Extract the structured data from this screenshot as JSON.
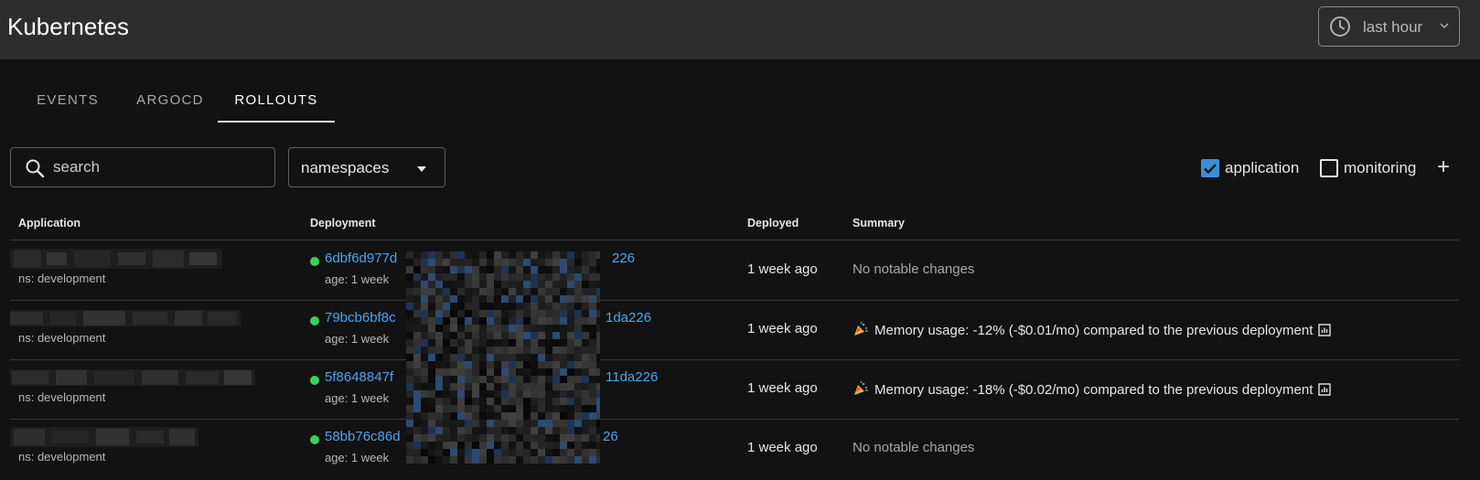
{
  "header": {
    "title": "Kubernetes",
    "time_range": "last hour"
  },
  "tabs": [
    {
      "label": "EVENTS",
      "active": false
    },
    {
      "label": "ARGOCD",
      "active": false
    },
    {
      "label": "ROLLOUTS",
      "active": true
    }
  ],
  "filters": {
    "search_placeholder": "search",
    "namespaces_label": "namespaces",
    "toggles": [
      {
        "label": "application",
        "checked": true
      },
      {
        "label": "monitoring",
        "checked": false
      }
    ],
    "add_label": "+"
  },
  "table": {
    "columns": [
      "Application",
      "Deployment",
      "Deployed",
      "Summary"
    ],
    "rows": [
      {
        "namespace": "ns: development",
        "deployment_prefix": "6dbf6d977d",
        "deployment_suffix": "226",
        "age": "age: 1 week",
        "deployed": "1 week ago",
        "summary": "No notable changes",
        "has_memory_change": false
      },
      {
        "namespace": "ns: development",
        "deployment_prefix": "79bcb6bf8c",
        "deployment_suffix": "1da226",
        "age": "age: 1 week",
        "deployed": "1 week ago",
        "summary": "Memory usage: -12% (-$0.01/mo) compared to the previous deployment",
        "has_memory_change": true
      },
      {
        "namespace": "ns: development",
        "deployment_prefix": "5f8648847f",
        "deployment_suffix": "11da226",
        "age": "age: 1 week",
        "deployed": "1 week ago",
        "summary": "Memory usage: -18% (-$0.02/mo) compared to the previous deployment",
        "has_memory_change": true
      },
      {
        "namespace": "ns: development",
        "deployment_prefix": "58bb76c86d",
        "deployment_suffix": "26",
        "age": "age: 1 week",
        "deployed": "1 week ago",
        "summary": "No notable changes",
        "has_memory_change": false
      }
    ]
  },
  "colors": {
    "accent": "#4ea3f0",
    "status_ok": "#3ccf5a",
    "checkbox": "#3b8fd9"
  }
}
